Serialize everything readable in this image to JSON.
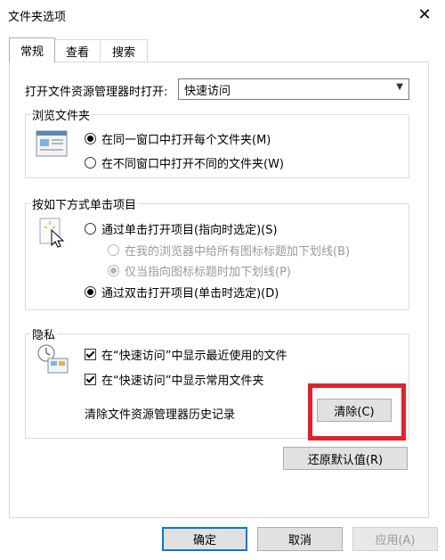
{
  "window": {
    "title": "文件夹选项"
  },
  "tabs": [
    {
      "label": "常规",
      "active": true
    },
    {
      "label": "查看",
      "active": false
    },
    {
      "label": "搜索",
      "active": false
    }
  ],
  "open_explorer": {
    "label": "打开文件资源管理器时打开:",
    "selected": "快速访问"
  },
  "browse_folders": {
    "title": "浏览文件夹",
    "options": [
      {
        "label": "在同一窗口中打开每个文件夹(M)",
        "checked": true
      },
      {
        "label": "在不同窗口中打开不同的文件夹(W)",
        "checked": false
      }
    ]
  },
  "click_items": {
    "title": "按如下方式单击项目",
    "options": [
      {
        "label": "通过单击打开项目(指向时选定)(S)",
        "checked": false,
        "disabled": false
      },
      {
        "label": "在我的浏览器中给所有图标标题加下划线(B)",
        "checked": false,
        "disabled": true
      },
      {
        "label": "仅当指向图标标题时加下划线(P)",
        "checked": true,
        "disabled": true
      },
      {
        "label": "通过双击打开项目(单击时选定)(D)",
        "checked": true,
        "disabled": false
      }
    ]
  },
  "privacy": {
    "title": "隐私",
    "options": [
      {
        "label": "在“快速访问”中显示最近使用的文件",
        "checked": true
      },
      {
        "label": "在“快速访问”中显示常用文件夹",
        "checked": true
      }
    ],
    "clear_history_label": "清除文件资源管理器历史记录",
    "clear_button": "清除(C)"
  },
  "restore_defaults_button": "还原默认值(R)",
  "footer": {
    "ok": "确定",
    "cancel": "取消",
    "apply": "应用(A)"
  },
  "colors": {
    "highlight": "#e0232a",
    "focus_border": "#0078d7"
  }
}
